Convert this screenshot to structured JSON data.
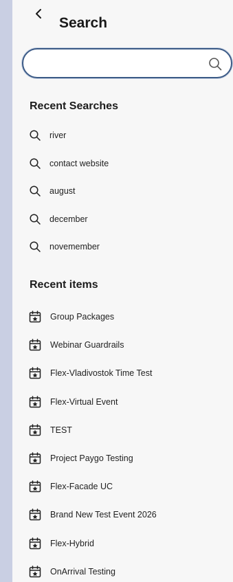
{
  "header": {
    "title": "Search"
  },
  "search": {
    "placeholder": "",
    "value": ""
  },
  "recent_searches": {
    "title": "Recent Searches",
    "items": [
      "river",
      "contact website",
      "august",
      "december",
      "novemember"
    ]
  },
  "recent_items": {
    "title": "Recent items",
    "items": [
      "Group Packages",
      "Webinar Guardrails",
      "Flex-Vladivostok Time Test",
      "Flex-Virtual Event",
      "TEST",
      "Project Paygo Testing",
      "Flex-Facade UC",
      "Brand New Test Event 2026",
      "Flex-Hybrid",
      "OnArrival Testing"
    ]
  },
  "colors": {
    "panel_bg": "#f7f7f7",
    "outer_bg": "#c9cfe3",
    "search_border": "#3b5a86",
    "text": "#1f1f1f"
  },
  "icons": {
    "back": "chevron-left-icon",
    "search": "search-icon",
    "event": "calendar-star-icon"
  }
}
